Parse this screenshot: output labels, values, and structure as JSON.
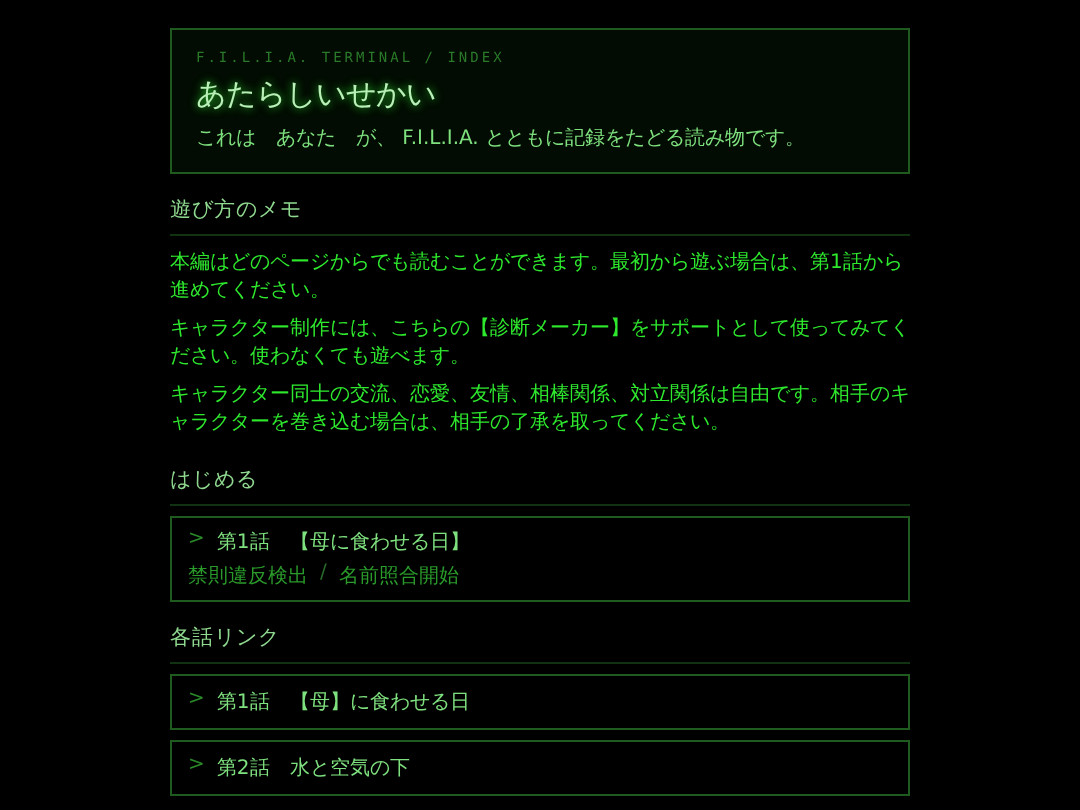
{
  "header": {
    "breadcrumb": "F.I.L.I.A. TERMINAL / INDEX",
    "title": "あたらしいせかい",
    "intro": "これは　あなた　が、 F.I.L.I.A. とともに記録をたどる読み物です。"
  },
  "memo": {
    "heading": "遊び方のメモ",
    "paragraphs": [
      "本編はどのページからでも読むことができます。最初から遊ぶ場合は、第1話から進めてください。",
      "キャラクター制作には、こちらの【診断メーカー】をサポートとして使ってみてください。使わなくても遊べます。",
      "キャラクター同士の交流、恋愛、友情、相棒関係、対立関係は自由です。相手のキャラクターを巻き込む場合は、相手の了承を取ってください。"
    ]
  },
  "start": {
    "heading": "はじめる",
    "card": {
      "marker": ">",
      "title": "第1話　【母に食わせる日】",
      "tags": [
        "禁則違反検出",
        "名前照合開始"
      ],
      "separator": "/"
    }
  },
  "episodes": {
    "heading": "各話リンク",
    "links": [
      {
        "marker": ">",
        "title": "第1話　【母】に食わせる日"
      },
      {
        "marker": ">",
        "title": "第2話　水と空気の下"
      }
    ]
  }
}
